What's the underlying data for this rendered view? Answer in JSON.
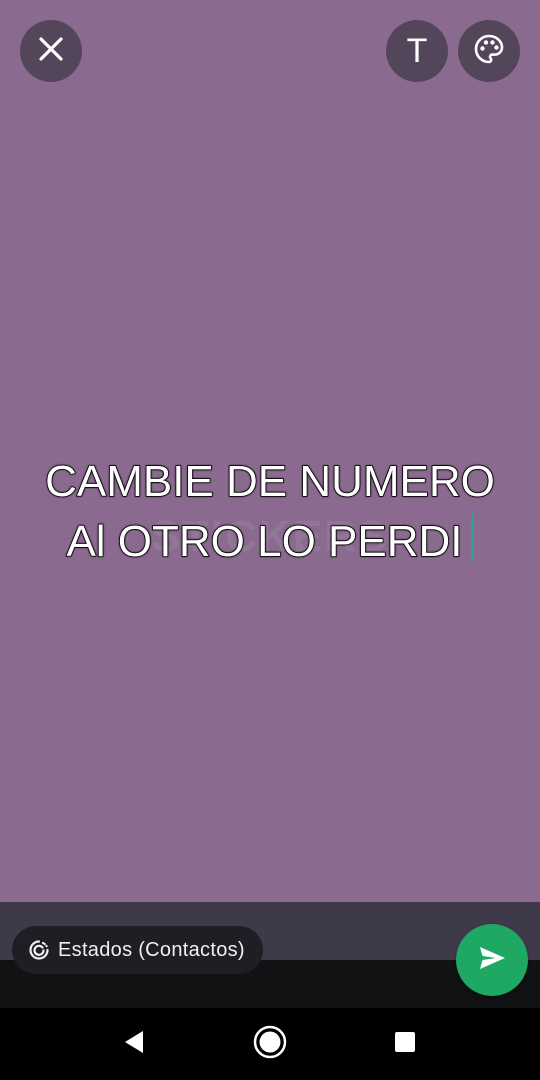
{
  "status_text": {
    "line1": "CAMBIE DE NUMERO",
    "line2": "Al OTRO LO PERDI"
  },
  "watermark": {
    "text": "STICKERS"
  },
  "toolbar": {
    "close_icon": "close-icon",
    "text_icon": "text-icon",
    "text_glyph": "T",
    "palette_icon": "palette-icon"
  },
  "audience": {
    "icon": "status-privacy-icon",
    "label": "Estados (Contactos)"
  },
  "send": {
    "icon": "send-icon"
  },
  "navigation": {
    "back_icon": "back-icon",
    "home_icon": "home-icon",
    "recents_icon": "recents-icon"
  },
  "colors": {
    "background": "#8b6a8f",
    "send_button": "#1ea863",
    "cursor": "#2aa48a",
    "bottom_bar": "#3f3a4a"
  }
}
